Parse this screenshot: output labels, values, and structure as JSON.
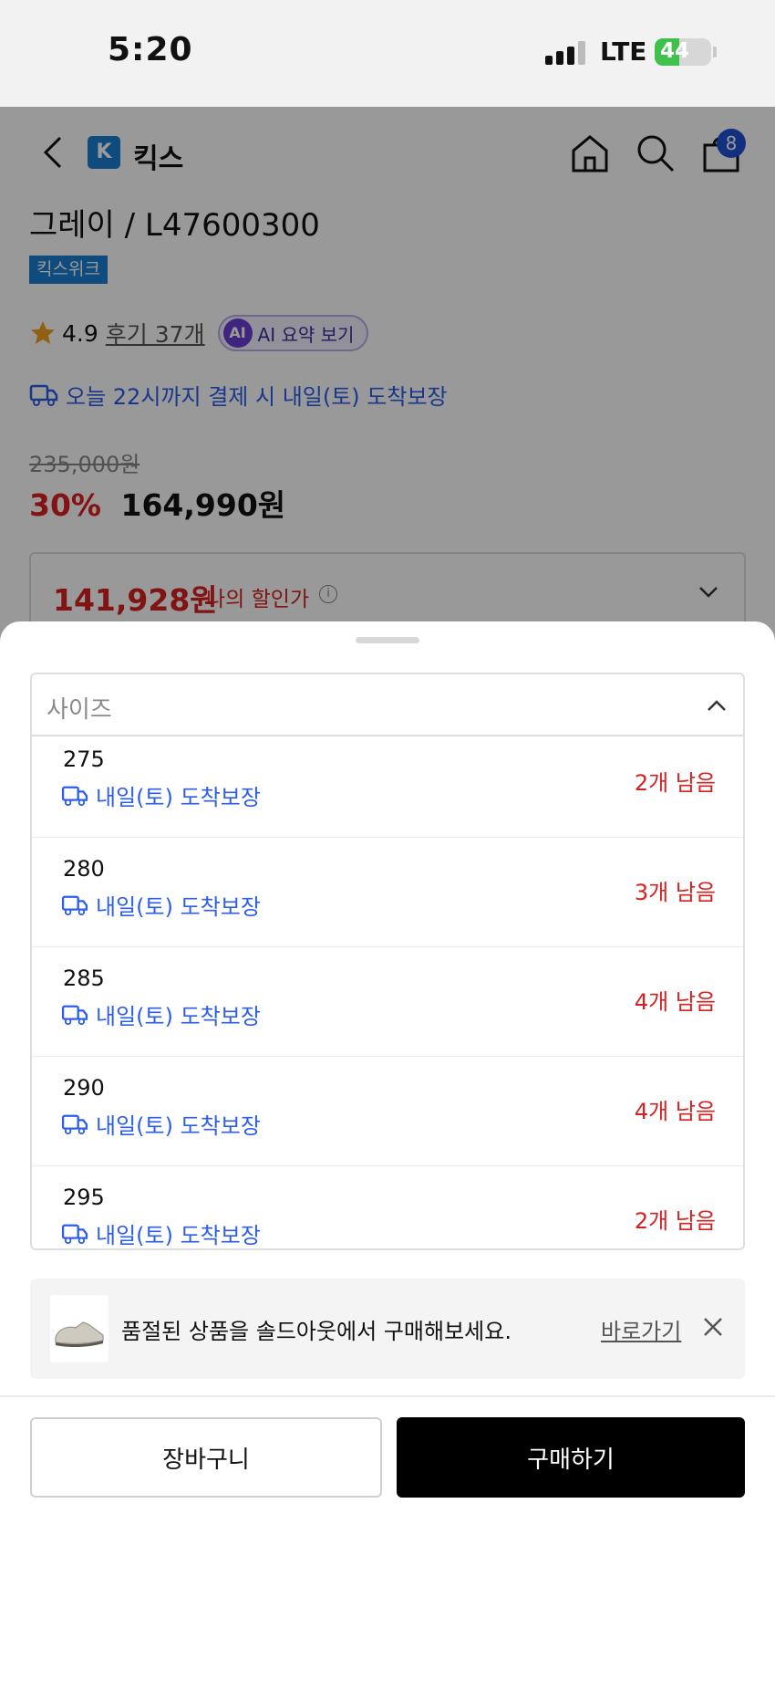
{
  "status_bar": {
    "time": "5:20",
    "network": "LTE",
    "battery": "44",
    "battery_fraction": 0.44
  },
  "header": {
    "brand_logo": "K",
    "brand_name": "킥스",
    "cart_count": "8"
  },
  "product": {
    "title": "그레이 / L47600300",
    "tag": "킥스위크",
    "rating": "4.9",
    "review_link": "후기 37개",
    "ai_button": "AI 요약 보기",
    "ai_icon_text": "AI",
    "delivery": "오늘 22시까지 결제 시 내일(토) 도착보장",
    "original_price": "235,000원",
    "discount_rate": "30%",
    "sale_price": "164,990원",
    "my_price": "141,928원",
    "my_price_label": "나의 할인가",
    "info_icon_text": "i"
  },
  "sheet": {
    "select_label": "사이즈",
    "sizes": [
      {
        "size": "275",
        "delivery": "내일(토) 도착보장",
        "stock": "2개 남음"
      },
      {
        "size": "280",
        "delivery": "내일(토) 도착보장",
        "stock": "3개 남음"
      },
      {
        "size": "285",
        "delivery": "내일(토) 도착보장",
        "stock": "4개 남음"
      },
      {
        "size": "290",
        "delivery": "내일(토) 도착보장",
        "stock": "4개 남음"
      },
      {
        "size": "295",
        "delivery": "내일(토) 도착보장",
        "stock": "2개 남음"
      }
    ],
    "banner_text": "품절된 상품을 솔드아웃에서 구매해보세요.",
    "banner_link": "바로가기",
    "cart_button": "장바구니",
    "buy_button": "구매하기"
  },
  "colors": {
    "accent_blue": "#2c5ee8",
    "price_red": "#d82020",
    "brand_blue": "#1a7fd0"
  },
  "icons": [
    "back-icon",
    "home-icon",
    "search-icon",
    "bag-icon",
    "star-icon",
    "delivery-truck-icon",
    "info-icon",
    "chevron-down-icon",
    "chevron-up-icon",
    "close-icon"
  ]
}
